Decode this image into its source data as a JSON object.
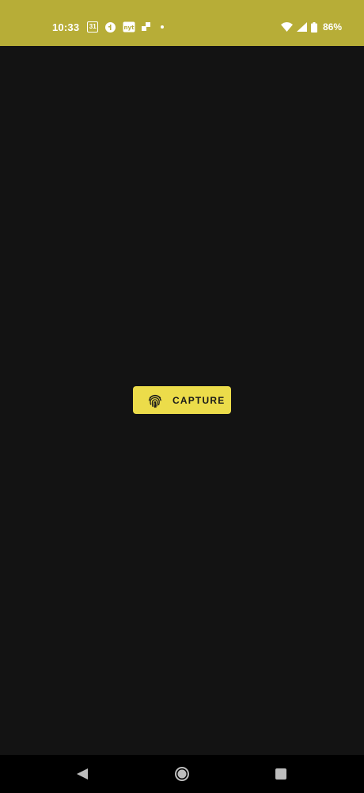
{
  "status_bar": {
    "time": "10:33",
    "calendar_day": "31",
    "battery": "86%",
    "background_color": "#b7ad37",
    "icons": [
      "calendar-icon",
      "google-icon",
      "nyt-icon",
      "app-icon",
      "dot-icon",
      "wifi-icon",
      "signal-icon",
      "battery-icon"
    ]
  },
  "main": {
    "capture_button": {
      "label": "CAPTURE",
      "icon": "fingerprint-icon",
      "color": "#ecdc4a"
    },
    "background_color": "#131313"
  },
  "nav_bar": {
    "buttons": [
      "back-icon",
      "home-icon",
      "recents-icon"
    ]
  }
}
